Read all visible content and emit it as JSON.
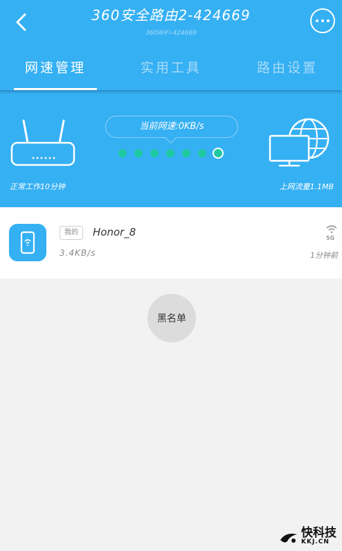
{
  "header": {
    "title": "360安全路由2-424669",
    "subtitle": "360WiFi-424669"
  },
  "tabs": [
    {
      "label": "网速管理",
      "active": true
    },
    {
      "label": "实用工具",
      "active": false
    },
    {
      "label": "路由设置",
      "active": false
    }
  ],
  "status": {
    "current_speed": "当前网速:0KB/s",
    "uptime": "正常工作10分钟",
    "traffic": "上网流量1.1MB"
  },
  "device": {
    "tag": "我的",
    "name": "Honor_8",
    "speed": "3.4KB/s",
    "band": "5G",
    "last_seen": "1分钟前"
  },
  "blacklist_label": "黑名单",
  "watermark": {
    "main": "快科技",
    "sub": "KKJ.CN"
  },
  "colors": {
    "primary": "#35b0f3",
    "indicator": "#1fc9a0",
    "background": "#f2f2f2"
  }
}
